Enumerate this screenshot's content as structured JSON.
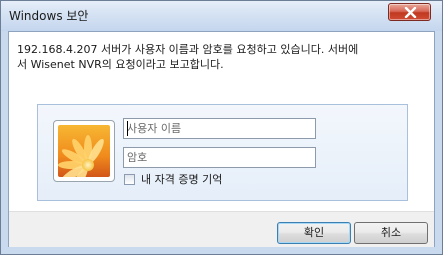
{
  "window": {
    "title": "Windows 보안",
    "close_label": "×"
  },
  "dialog": {
    "message": "192.168.4.207 서버가 사용자 이름과 암호를 요청하고 있습니다. 서버에\n서 Wisenet NVR의 요청이라고 보고합니다."
  },
  "credentials": {
    "avatar_icon": "user-tile-flower-icon",
    "username_value": "",
    "username_placeholder": "사용자 이름",
    "password_value": "",
    "password_placeholder": "암호",
    "remember_label": "내 자격 증명 기억",
    "remember_checked": false
  },
  "buttons": {
    "ok_label": "확인",
    "cancel_label": "취소"
  },
  "colors": {
    "title_bar": "#d5e2f3",
    "close_button": "#c0391f",
    "button_bar": "#f0f0f0",
    "default_button_border": "#3c7fb1"
  }
}
